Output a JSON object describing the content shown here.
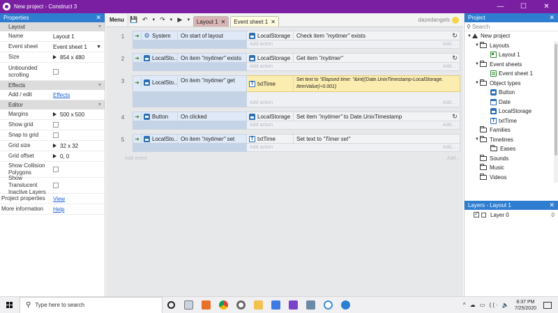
{
  "window": {
    "title": "New project - Construct 3",
    "minimize": "—",
    "maximize": "☐",
    "close": "✕"
  },
  "properties": {
    "title": "Properties",
    "close": "✕",
    "sections": [
      {
        "label": "Layout",
        "rows": [
          {
            "key": "Name",
            "value": "Layout 1"
          },
          {
            "key": "Event sheet",
            "value": "Event sheet 1"
          },
          {
            "key": "Size",
            "value": "854 x 480"
          },
          {
            "key": "Unbounded scrolling",
            "value": ""
          }
        ]
      },
      {
        "label": "Effects",
        "rows": [
          {
            "key": "Add / edit",
            "value": "Effects"
          }
        ]
      },
      {
        "label": "Editor",
        "rows": [
          {
            "key": "Margins",
            "value": "500 x 500"
          },
          {
            "key": "Show grid",
            "value": ""
          },
          {
            "key": "Snap to grid",
            "value": ""
          },
          {
            "key": "Grid size",
            "value": "32 x 32"
          },
          {
            "key": "Grid offset",
            "value": "0, 0"
          },
          {
            "key": "Show Collision Polygons",
            "value": ""
          },
          {
            "key": "Show Translucent Inactive Layers",
            "value": ""
          }
        ]
      }
    ],
    "footer": [
      {
        "key": "Project properties",
        "value": "View"
      },
      {
        "key": "More information",
        "value": "Help"
      }
    ]
  },
  "toolbar": {
    "menu": "Menu",
    "tabs": [
      {
        "label": "Layout 1",
        "close": "✕"
      },
      {
        "label": "Event sheet 1",
        "close": "✕"
      }
    ],
    "username": "dazedangels"
  },
  "events": [
    {
      "num": "1",
      "cond_obj": "System",
      "cond": "On start of layout",
      "act_obj": "LocalStorage",
      "act_pre": "Check item ",
      "act_em": "\"mytimer\"",
      "act_post": " exists",
      "refresh": true
    },
    {
      "num": "2",
      "cond_obj": "LocalSto...",
      "cond_pre": "On item ",
      "cond_em": "\"mytimer\"",
      "cond_post": " exists",
      "act_obj": "LocalStorage",
      "act_pre": "Get item ",
      "act_em": "\"mytimer\"",
      "act_post": "",
      "refresh": true
    },
    {
      "num": "3",
      "cond_obj": "LocalSto...",
      "cond_pre": "On item ",
      "cond_em": "\"mytimer\"",
      "cond_post": " get",
      "act_obj": "txtTime",
      "act_pre": "Set text to ",
      "act_em": "\"Elapsed time: \"&int((Date.UnixTimestamp-LocalStorage.",
      "act_em2": "ItemValue)÷0.001)",
      "refresh": false
    },
    {
      "num": "4",
      "cond_obj": "Button",
      "cond": "On clicked",
      "act_obj": "LocalStorage",
      "act_pre": "Set item ",
      "act_em": "\"mytimer\"",
      "act_post": " to Date.UnixTimestamp",
      "refresh": true
    },
    {
      "num": "5",
      "cond_obj": "LocalSto...",
      "cond_pre": "On item ",
      "cond_em": "\"mytimer\"",
      "cond_post": " set",
      "act_obj": "txtTime",
      "act_pre": "Set text to ",
      "act_em": "\"Timer set\"",
      "act_post": "",
      "refresh": false
    }
  ],
  "add_action": "Add action",
  "add_more": "Add...",
  "add_event": "Add event",
  "project": {
    "title": "Project",
    "close": "✕",
    "search_placeholder": "Search",
    "tree": [
      {
        "label": "New project",
        "level": 0,
        "kind": "project",
        "expand": "▼"
      },
      {
        "label": "Layouts",
        "level": 1,
        "kind": "folder",
        "expand": "▼"
      },
      {
        "label": "Layout 1",
        "level": 2,
        "kind": "layout"
      },
      {
        "label": "Event sheets",
        "level": 1,
        "kind": "folder",
        "expand": "▼"
      },
      {
        "label": "Event sheet 1",
        "level": 2,
        "kind": "sheet"
      },
      {
        "label": "Object types",
        "level": 1,
        "kind": "folder",
        "expand": "▼"
      },
      {
        "label": "Button",
        "level": 2,
        "kind": "btn"
      },
      {
        "label": "Date",
        "level": 2,
        "kind": "date"
      },
      {
        "label": "LocalStorage",
        "level": 2,
        "kind": "ls"
      },
      {
        "label": "txtTime",
        "level": 2,
        "kind": "txt"
      },
      {
        "label": "Families",
        "level": 1,
        "kind": "folder"
      },
      {
        "label": "Timelines",
        "level": 1,
        "kind": "folder",
        "expand": "▼"
      },
      {
        "label": "Eases",
        "level": 2,
        "kind": "folder"
      },
      {
        "label": "Sounds",
        "level": 1,
        "kind": "folder"
      },
      {
        "label": "Music",
        "level": 1,
        "kind": "folder"
      },
      {
        "label": "Videos",
        "level": 1,
        "kind": "folder"
      }
    ]
  },
  "layers": {
    "title": "Layers - Layout 1",
    "close": "✕",
    "rows": [
      {
        "name": "Layer 0",
        "count": "0"
      }
    ]
  },
  "taskbar": {
    "search_placeholder": "Type here to search",
    "time": "8:37 PM",
    "date": "7/25/2020",
    "tray_glyphs": "^ ☁ ▭ ((· 🔈"
  },
  "colors": {
    "titlebar": "#7a1fa2",
    "panel_header": "#2f7dd0",
    "highlight_action": "#fbecb0"
  }
}
